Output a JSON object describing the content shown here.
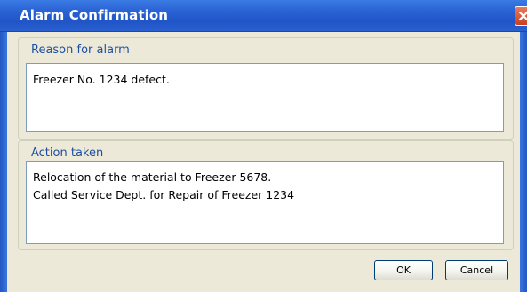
{
  "window": {
    "title": "Alarm Confirmation",
    "close_icon": "close-icon"
  },
  "reason_group": {
    "label": "Reason for alarm",
    "text_lines": [
      "Freezer No. 1234 defect."
    ]
  },
  "action_group": {
    "label": "Action taken",
    "text_lines": [
      "Relocation of the material to Freezer 5678.",
      "Called Service Dept. for Repair of Freezer 1234"
    ]
  },
  "buttons": {
    "ok_label": "OK",
    "cancel_label": "Cancel"
  },
  "colors": {
    "titlebar": "#2a63d4",
    "dialog_bg": "#ece9d8",
    "group_label": "#1f4fa0",
    "close_button": "#c9401f"
  }
}
